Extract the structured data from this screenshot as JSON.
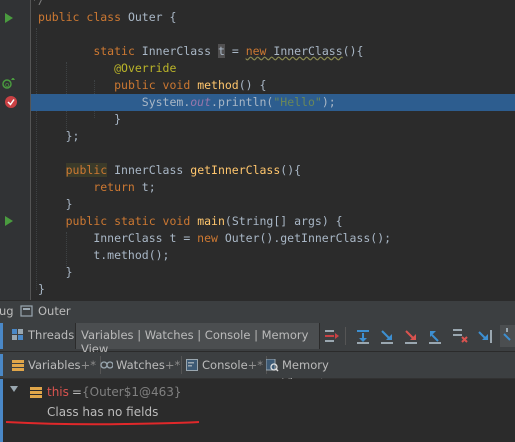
{
  "code": [
    {
      "pre": "",
      "kw": "public class ",
      "rest": "Outer {"
    },
    {
      "indent": "    ",
      "kw": "static ",
      "type": "InnerClass ",
      "var": "t",
      "eq": " = ",
      "kw2": "new ",
      "ctor": "InnerClass",
      "tail": "(){"
    },
    {
      "annotation": "@Override"
    },
    {
      "kw": "public void ",
      "fn": "method",
      "tail": "() {"
    },
    {
      "pre": "System.",
      "fld": "out",
      "mid": ".println(",
      "str": "\"Hello\"",
      "tail": ");"
    },
    {
      "text": "}"
    },
    {
      "text": "};"
    },
    {
      "kw": "public",
      "rest": " InnerClass ",
      "fn": "getInnerClass",
      "tail": "(){"
    },
    {
      "kw": "return ",
      "rest": "t;"
    },
    {
      "text": "}"
    },
    {
      "kw": "public static void ",
      "fn": "main",
      "tail": "(String[] args) {"
    },
    {
      "pre": "InnerClass t = ",
      "kw": "new ",
      "tail": "Outer().getInnerClass();"
    },
    {
      "text": "t.method();"
    },
    {
      "text": "}"
    },
    {
      "text": "}"
    },
    {
      "comment": "*/"
    }
  ],
  "debug_header": {
    "label_prefix": "ug",
    "session_label": "Outer"
  },
  "debug_tabs": {
    "threads": "Threads",
    "restored_tabs": "Variables | Watches | Console | Memory View"
  },
  "view_tabs": [
    {
      "label": "Variables",
      "icon": "variables-icon"
    },
    {
      "label": "Watches",
      "icon": "watches-icon"
    },
    {
      "label": "Console",
      "icon": "console-icon"
    },
    {
      "label": "Memory View",
      "icon": "memory-view-icon"
    }
  ],
  "pin_marker": "+*",
  "variables": {
    "this_name": "this",
    "this_eq": " = ",
    "this_value": "{Outer$1@463}",
    "no_fields": "Class has no fields"
  },
  "colors": {
    "editor_bg": "#2b2b2b",
    "line_highlight": "#2d5d8f",
    "keyword": "#cc7832",
    "string": "#6a8759",
    "function": "#ffc66d",
    "annotation": "#bbb529",
    "panel_bg": "#3c3f41",
    "red_underline": "#e0282a"
  }
}
